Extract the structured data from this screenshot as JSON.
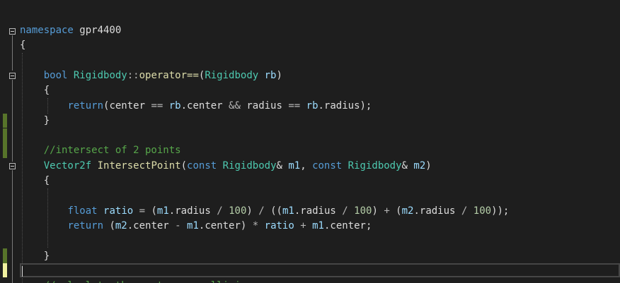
{
  "lines": [
    [
      {
        "t": "namespace",
        "c": "kw"
      },
      {
        "t": " gpr4400",
        "c": "plain"
      }
    ],
    [
      {
        "t": "{",
        "c": "plain"
      }
    ],
    [],
    [
      {
        "t": "    ",
        "c": "plain"
      },
      {
        "t": "bool",
        "c": "kw"
      },
      {
        "t": " ",
        "c": "plain"
      },
      {
        "t": "Rigidbody",
        "c": "type"
      },
      {
        "t": "::",
        "c": "op"
      },
      {
        "t": "operator==",
        "c": "fn"
      },
      {
        "t": "(",
        "c": "plain"
      },
      {
        "t": "Rigidbody",
        "c": "type"
      },
      {
        "t": " ",
        "c": "plain"
      },
      {
        "t": "rb",
        "c": "par"
      },
      {
        "t": ")",
        "c": "plain"
      }
    ],
    [
      {
        "t": "    {",
        "c": "plain"
      }
    ],
    [
      {
        "t": "        ",
        "c": "plain"
      },
      {
        "t": "return",
        "c": "kw"
      },
      {
        "t": "(center ",
        "c": "plain"
      },
      {
        "t": "==",
        "c": "op"
      },
      {
        "t": " ",
        "c": "plain"
      },
      {
        "t": "rb",
        "c": "par"
      },
      {
        "t": ".center ",
        "c": "plain"
      },
      {
        "t": "&&",
        "c": "op"
      },
      {
        "t": " radius ",
        "c": "plain"
      },
      {
        "t": "==",
        "c": "op"
      },
      {
        "t": " ",
        "c": "plain"
      },
      {
        "t": "rb",
        "c": "par"
      },
      {
        "t": ".radius);",
        "c": "plain"
      }
    ],
    [
      {
        "t": "    }",
        "c": "plain"
      }
    ],
    [],
    [
      {
        "t": "    ",
        "c": "plain"
      },
      {
        "t": "//intersect of 2 points",
        "c": "cm"
      }
    ],
    [
      {
        "t": "    ",
        "c": "plain"
      },
      {
        "t": "Vector2f",
        "c": "type"
      },
      {
        "t": " ",
        "c": "plain"
      },
      {
        "t": "IntersectPoint",
        "c": "fn"
      },
      {
        "t": "(",
        "c": "plain"
      },
      {
        "t": "const",
        "c": "kw"
      },
      {
        "t": " ",
        "c": "plain"
      },
      {
        "t": "Rigidbody",
        "c": "type"
      },
      {
        "t": "& ",
        "c": "plain"
      },
      {
        "t": "m1",
        "c": "par"
      },
      {
        "t": ", ",
        "c": "plain"
      },
      {
        "t": "const",
        "c": "kw"
      },
      {
        "t": " ",
        "c": "plain"
      },
      {
        "t": "Rigidbody",
        "c": "type"
      },
      {
        "t": "& ",
        "c": "plain"
      },
      {
        "t": "m2",
        "c": "par"
      },
      {
        "t": ")",
        "c": "plain"
      }
    ],
    [
      {
        "t": "    {",
        "c": "plain"
      }
    ],
    [],
    [
      {
        "t": "        ",
        "c": "plain"
      },
      {
        "t": "float",
        "c": "kw"
      },
      {
        "t": " ",
        "c": "plain"
      },
      {
        "t": "ratio",
        "c": "par"
      },
      {
        "t": " ",
        "c": "plain"
      },
      {
        "t": "=",
        "c": "op"
      },
      {
        "t": " (",
        "c": "plain"
      },
      {
        "t": "m1",
        "c": "par"
      },
      {
        "t": ".radius ",
        "c": "plain"
      },
      {
        "t": "/",
        "c": "op"
      },
      {
        "t": " ",
        "c": "plain"
      },
      {
        "t": "100",
        "c": "num"
      },
      {
        "t": ") ",
        "c": "plain"
      },
      {
        "t": "/",
        "c": "op"
      },
      {
        "t": " ((",
        "c": "plain"
      },
      {
        "t": "m1",
        "c": "par"
      },
      {
        "t": ".radius ",
        "c": "plain"
      },
      {
        "t": "/",
        "c": "op"
      },
      {
        "t": " ",
        "c": "plain"
      },
      {
        "t": "100",
        "c": "num"
      },
      {
        "t": ") ",
        "c": "plain"
      },
      {
        "t": "+",
        "c": "op"
      },
      {
        "t": " (",
        "c": "plain"
      },
      {
        "t": "m2",
        "c": "par"
      },
      {
        "t": ".radius ",
        "c": "plain"
      },
      {
        "t": "/",
        "c": "op"
      },
      {
        "t": " ",
        "c": "plain"
      },
      {
        "t": "100",
        "c": "num"
      },
      {
        "t": "));",
        "c": "plain"
      }
    ],
    [
      {
        "t": "        ",
        "c": "plain"
      },
      {
        "t": "return",
        "c": "kw"
      },
      {
        "t": " (",
        "c": "plain"
      },
      {
        "t": "m2",
        "c": "par"
      },
      {
        "t": ".center ",
        "c": "plain"
      },
      {
        "t": "-",
        "c": "op"
      },
      {
        "t": " ",
        "c": "plain"
      },
      {
        "t": "m1",
        "c": "par"
      },
      {
        "t": ".center) ",
        "c": "plain"
      },
      {
        "t": "*",
        "c": "op"
      },
      {
        "t": " ",
        "c": "plain"
      },
      {
        "t": "ratio",
        "c": "par"
      },
      {
        "t": " ",
        "c": "plain"
      },
      {
        "t": "+",
        "c": "op"
      },
      {
        "t": " ",
        "c": "plain"
      },
      {
        "t": "m1",
        "c": "par"
      },
      {
        "t": ".center;",
        "c": "plain"
      }
    ],
    [],
    [
      {
        "t": "    }",
        "c": "plain"
      }
    ],
    [],
    [
      {
        "t": "    ",
        "c": "plain"
      },
      {
        "t": "//calculate the vector ro collisiony",
        "c": "cm"
      }
    ]
  ],
  "colors": {
    "background": "#1e1e1e",
    "keyword": "#569cd6",
    "type": "#4ec9b0",
    "function": "#dcdcaa",
    "parameter": "#9cdcfe",
    "number": "#b5cea8",
    "comment": "#57a64a",
    "change_saved": "#57742a",
    "change_unsaved": "#f0f0a0"
  }
}
